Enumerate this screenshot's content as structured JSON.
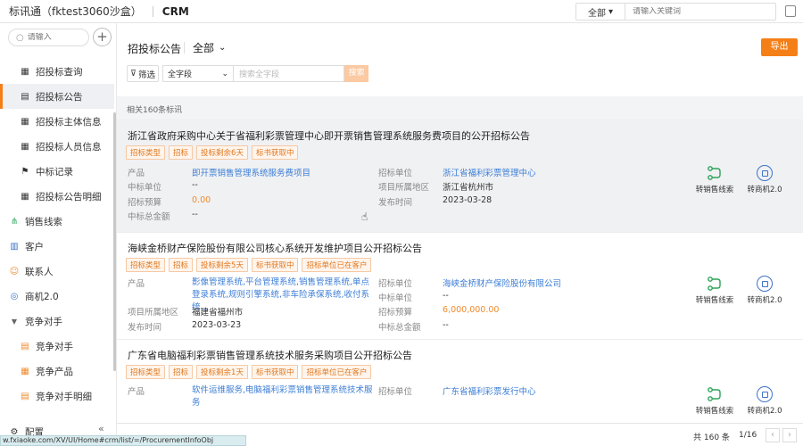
{
  "topbar": {
    "app_name": "标讯通（fktest3060沙盒）",
    "module": "CRM",
    "scope": "全部",
    "search_placeholder": "请输入关键词"
  },
  "sidebar": {
    "search_placeholder": "请输入",
    "items": [
      {
        "label": "招投标查询",
        "icon": "grid-icon"
      },
      {
        "label": "招投标公告",
        "icon": "document-icon",
        "active": true
      },
      {
        "label": "招投标主体信息",
        "icon": "grid-icon"
      },
      {
        "label": "招投标人员信息",
        "icon": "grid-icon"
      },
      {
        "label": "中标记录",
        "icon": "flag-icon"
      },
      {
        "label": "招投标公告明细",
        "icon": "grid-icon"
      },
      {
        "label": "销售线索",
        "icon": "clue-icon"
      },
      {
        "label": "客户",
        "icon": "building-icon"
      },
      {
        "label": "联系人",
        "icon": "person-icon"
      },
      {
        "label": "商机2.0",
        "icon": "circle-icon"
      },
      {
        "label": "竞争对手",
        "icon": "caret-down-icon"
      },
      {
        "label": "竞争对手",
        "icon": "document-icon"
      },
      {
        "label": "竞争产品",
        "icon": "grid-icon"
      },
      {
        "label": "竞争对手明细",
        "icon": "document-icon"
      },
      {
        "label": "配置",
        "icon": "gear-icon"
      }
    ],
    "collapse_label": "«"
  },
  "main": {
    "title": "招投标公告",
    "view": "全部",
    "export_label": "导出",
    "filter_label": "筛选",
    "field_select": "全字段",
    "keyword_placeholder": "搜索全字段",
    "search_label": "搜索",
    "count_text": "相关160条标讯"
  },
  "cards": [
    {
      "title": "浙江省政府采购中心关于省福利彩票管理中心即开票销售管理系统服务费项目的公开招标公告",
      "tags": [
        "招标类型",
        "招标",
        "投标剩余6天",
        "标书获取中"
      ],
      "left": [
        {
          "k": "产品",
          "v": "即开票销售管理系统服务费项目",
          "style": "link"
        },
        {
          "k": "中标单位",
          "v": "--",
          "style": ""
        },
        {
          "k": "招标预算",
          "v": "0.00",
          "style": "orange"
        },
        {
          "k": "中标总金额",
          "v": "--",
          "style": ""
        }
      ],
      "right": [
        {
          "k": "招标单位",
          "v": "浙江省福利彩票管理中心",
          "style": "link"
        },
        {
          "k": "项目所属地区",
          "v": "浙江省杭州市",
          "style": ""
        },
        {
          "k": "发布时间",
          "v": "2023-03-28",
          "style": ""
        }
      ],
      "actions": [
        "转销售线索",
        "转商机2.0"
      ]
    },
    {
      "title": "海峡金桥财产保险股份有限公司核心系统开发维护项目公开招标公告",
      "tags": [
        "招标类型",
        "招标",
        "投标剩余5天",
        "标书获取中",
        "招标单位已在客户"
      ],
      "left": [
        {
          "k": "产品",
          "v": "影像管理系统,平台管理系统,销售管理系统,单点登录系统,规则引擎系统,非车险承保系统,收付系统...",
          "style": "link"
        },
        {
          "k": "项目所属地区",
          "v": "福建省福州市",
          "style": ""
        },
        {
          "k": "发布时间",
          "v": "2023-03-23",
          "style": ""
        }
      ],
      "right": [
        {
          "k": "招标单位",
          "v": "海峡金桥财产保险股份有限公司",
          "style": "link"
        },
        {
          "k": "中标单位",
          "v": "--",
          "style": ""
        },
        {
          "k": "招标预算",
          "v": "6,000,000.00",
          "style": "orange"
        },
        {
          "k": "中标总金额",
          "v": "--",
          "style": ""
        }
      ],
      "actions": [
        "转销售线索",
        "转商机2.0"
      ]
    },
    {
      "title": "广东省电脑福利彩票销售管理系统技术服务采购项目公开招标公告",
      "tags": [
        "招标类型",
        "招标",
        "投标剩余1天",
        "标书获取中",
        "招标单位已在客户"
      ],
      "left": [
        {
          "k": "产品",
          "v": "软件运维服务,电脑福利彩票销售管理系统技术服务",
          "style": "link"
        }
      ],
      "right": [
        {
          "k": "招标单位",
          "v": "广东省福利彩票发行中心",
          "style": "link"
        }
      ],
      "actions": [
        "转销售线索",
        "转商机2.0"
      ]
    }
  ],
  "pager": {
    "total": "共 160 条",
    "page": "1/16"
  },
  "status_url": "w.fxiaoke.com/XV/UI/Home#crm/list/=/ProcurementInfoObj"
}
